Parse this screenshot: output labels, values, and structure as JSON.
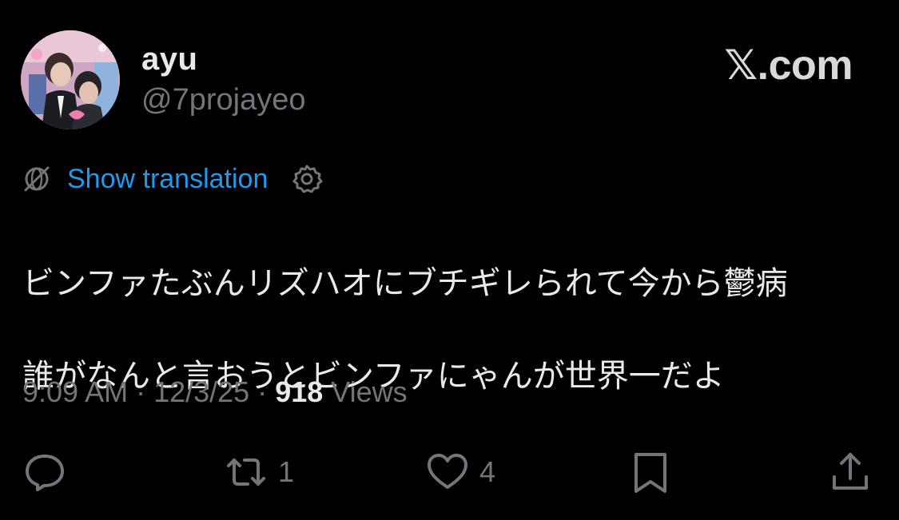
{
  "header": {
    "display_name": "ayu",
    "handle": "@7projayeo",
    "brand": "𝕏.com",
    "avatar": "avatar-photo"
  },
  "translation": {
    "link_label": "Show translation",
    "icons": [
      "globe-slash-icon",
      "gear-icon"
    ]
  },
  "tweet": {
    "line1": "ビンファたぶんリズハオにブチギレられて今から鬱病",
    "line2": "誰がなんと言おうとビンファにゃんが世界一だよ"
  },
  "meta": {
    "time": "9:09 AM",
    "separator1": " · ",
    "date": "12/3/25",
    "separator2": " · ",
    "views_count": "918",
    "views_label": " Views"
  },
  "actions": {
    "reply_count": "",
    "repost_count": "1",
    "like_count": "4",
    "icons": [
      "reply-icon",
      "repost-icon",
      "like-icon",
      "bookmark-icon",
      "share-icon"
    ]
  },
  "colors": {
    "background": "#000000",
    "text": "#e7e9ea",
    "muted": "#71767b",
    "link": "#1d9bf0"
  }
}
